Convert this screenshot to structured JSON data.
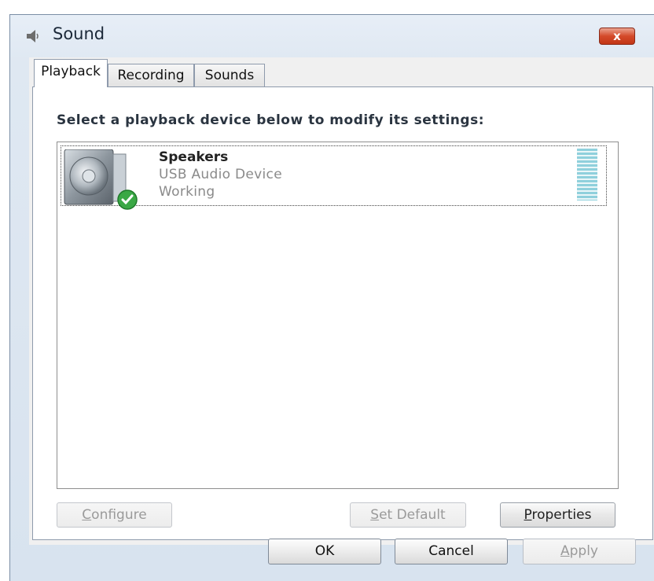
{
  "window": {
    "title": "Sound",
    "icon": "speaker-icon",
    "close_label": "x"
  },
  "tabs": [
    {
      "label": "Playback",
      "active": true
    },
    {
      "label": "Recording",
      "active": false
    },
    {
      "label": "Sounds",
      "active": false
    }
  ],
  "playback": {
    "instruction": "Select a playback device below to modify its settings:",
    "devices": [
      {
        "name": "Speakers",
        "description": "USB Audio Device",
        "status": "Working",
        "icon": "speaker-device-icon",
        "default_badge": "green-check-icon"
      }
    ],
    "buttons": {
      "configure": {
        "accel": "C",
        "rest": "onfigure",
        "enabled": false
      },
      "set_default": {
        "accel": "S",
        "rest": "et Default",
        "enabled": false
      },
      "properties": {
        "accel": "P",
        "rest": "roperties",
        "enabled": true
      }
    }
  },
  "footer": {
    "ok": "OK",
    "cancel": "Cancel",
    "apply_accel": "A",
    "apply_rest": "pply",
    "apply_enabled": false
  },
  "colors": {
    "close_button": "#d44a2a",
    "badge_green": "#3aa845",
    "level_meter": "#8fd0dc"
  }
}
